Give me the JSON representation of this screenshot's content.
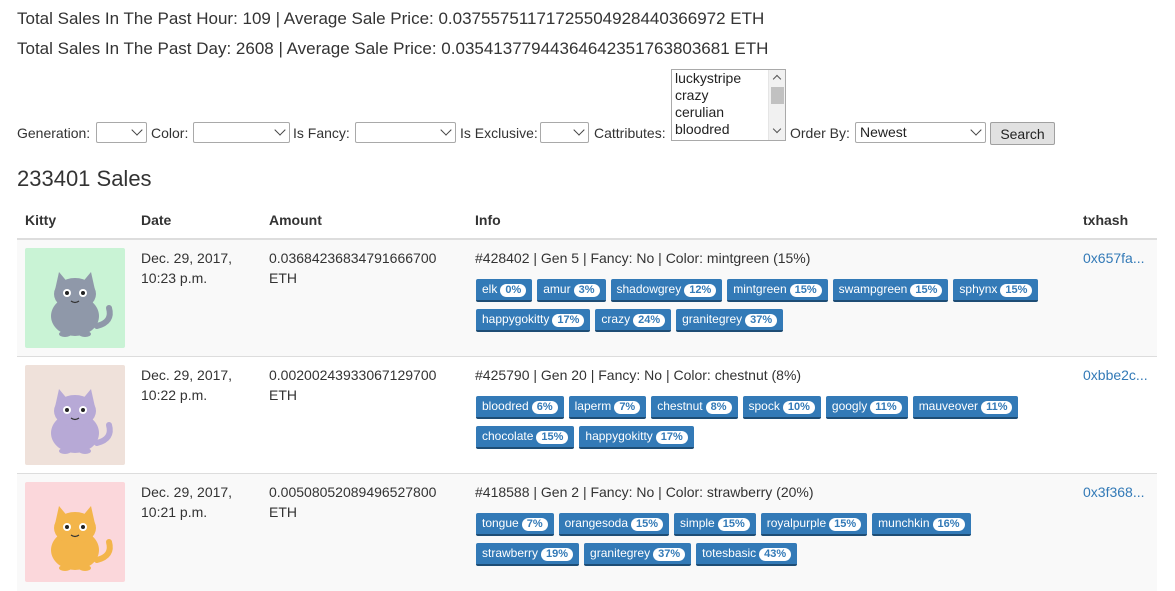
{
  "stats": {
    "hour": "Total Sales In The Past Hour: 109 | Average Sale Price: 0.0375575117172550492844036697​2 ETH",
    "day": "Total Sales In The Past Day: 2608 | Average Sale Price: 0.0354137794436464235176380368​1 ETH"
  },
  "filters": {
    "generation_label": "Generation:",
    "color_label": "Color:",
    "fancy_label": "Is Fancy:",
    "exclusive_label": "Is Exclusive:",
    "cattributes_label": "Cattributes:",
    "cattributes_options": [
      "luckystripe",
      "crazy",
      "cerulian",
      "bloodred"
    ],
    "order_label": "Order By:",
    "order_value": "Newest",
    "search_label": "Search"
  },
  "sales_count": "233401 Sales",
  "table": {
    "headers": [
      "Kitty",
      "Date",
      "Amount",
      "Info",
      "txhash"
    ],
    "rows": [
      {
        "date1": "Dec. 29, 2017,",
        "date2": "10:23 p.m.",
        "amount1": "0.03684236834791666700",
        "amount2": "ETH",
        "info": "#428402 | Gen 5 | Fancy: No | Color: mintgreen (15%)",
        "tags": [
          {
            "name": "elk",
            "pct": "0%"
          },
          {
            "name": "amur",
            "pct": "3%"
          },
          {
            "name": "shadowgrey",
            "pct": "12%"
          },
          {
            "name": "mintgreen",
            "pct": "15%"
          },
          {
            "name": "swampgreen",
            "pct": "15%"
          },
          {
            "name": "sphynx",
            "pct": "15%"
          },
          {
            "name": "happygokitty",
            "pct": "17%"
          },
          {
            "name": "crazy",
            "pct": "24%"
          },
          {
            "name": "granitegrey",
            "pct": "37%"
          }
        ],
        "tx": "0x657fa...",
        "bg": "#c9f3d5",
        "body": "#8f98a9"
      },
      {
        "date1": "Dec. 29, 2017,",
        "date2": "10:22 p.m.",
        "amount1": "0.00200243933067129700",
        "amount2": "ETH",
        "info": "#425790 | Gen 20 | Fancy: No | Color: chestnut (8%)",
        "tags": [
          {
            "name": "bloodred",
            "pct": "6%"
          },
          {
            "name": "laperm",
            "pct": "7%"
          },
          {
            "name": "chestnut",
            "pct": "8%"
          },
          {
            "name": "spock",
            "pct": "10%"
          },
          {
            "name": "googly",
            "pct": "11%"
          },
          {
            "name": "mauveover",
            "pct": "11%"
          },
          {
            "name": "chocolate",
            "pct": "15%"
          },
          {
            "name": "happygokitty",
            "pct": "17%"
          }
        ],
        "tx": "0xbbe2c...",
        "bg": "#efe1da",
        "body": "#b7a9d6"
      },
      {
        "date1": "Dec. 29, 2017,",
        "date2": "10:21 p.m.",
        "amount1": "0.00508052089496527800",
        "amount2": "ETH",
        "info": "#418588 | Gen 2 | Fancy: No | Color: strawberry (20%)",
        "tags": [
          {
            "name": "tongue",
            "pct": "7%"
          },
          {
            "name": "orangesoda",
            "pct": "15%"
          },
          {
            "name": "simple",
            "pct": "15%"
          },
          {
            "name": "royalpurple",
            "pct": "15%"
          },
          {
            "name": "munchkin",
            "pct": "16%"
          },
          {
            "name": "strawberry",
            "pct": "19%"
          },
          {
            "name": "granitegrey",
            "pct": "37%"
          },
          {
            "name": "totesbasic",
            "pct": "43%"
          }
        ],
        "tx": "0x3f368...",
        "bg": "#fbd7db",
        "body": "#f3b54a"
      }
    ]
  }
}
